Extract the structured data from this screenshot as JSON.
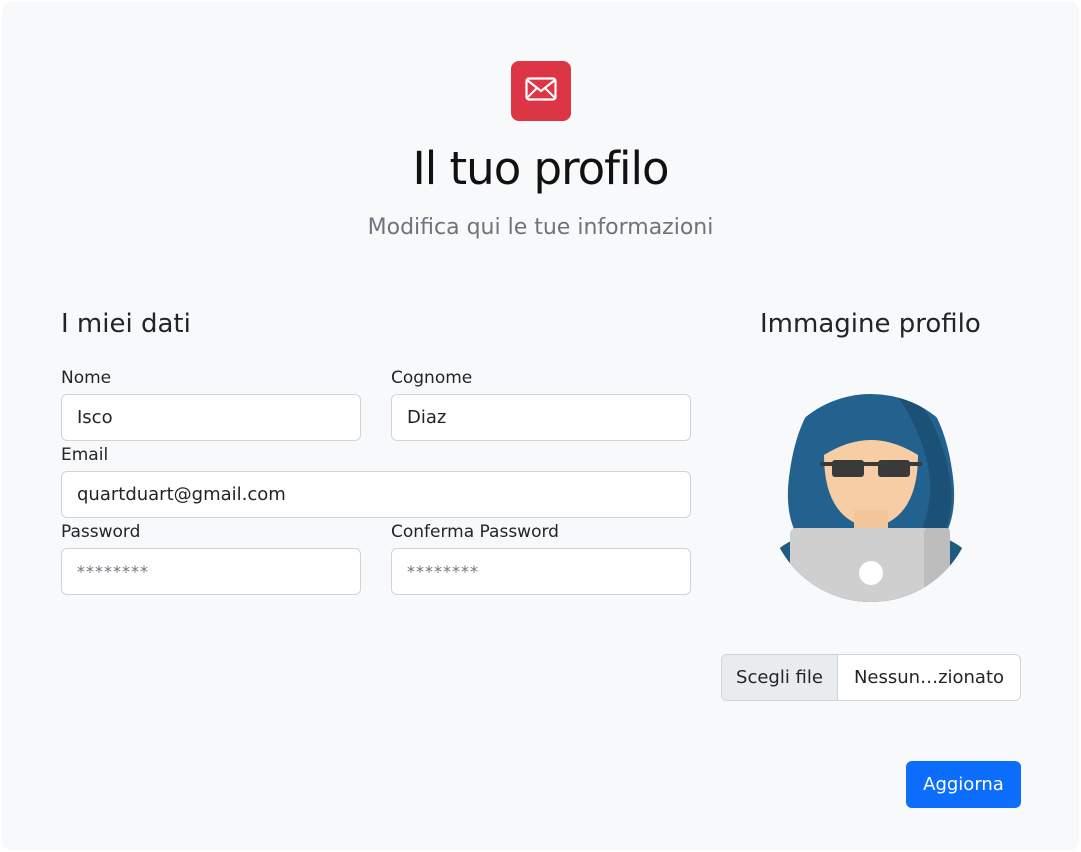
{
  "header": {
    "icon": "envelope-icon",
    "title": "Il tuo profilo",
    "subtitle": "Modifica qui le tue informazioni"
  },
  "form": {
    "section_title": "I miei dati",
    "first_name": {
      "label": "Nome",
      "value": "Isco"
    },
    "last_name": {
      "label": "Cognome",
      "value": "Diaz"
    },
    "email": {
      "label": "Email",
      "value": "quartduart@gmail.com"
    },
    "password": {
      "label": "Password",
      "placeholder": "********"
    },
    "confirm_password": {
      "label": "Conferma Password",
      "placeholder": "********"
    }
  },
  "profile_image": {
    "section_title": "Immagine profilo",
    "avatar": "hacker-avatar",
    "file_button": "Scegli file",
    "file_status": "Nessun…zionato"
  },
  "actions": {
    "submit_label": "Aggiorna"
  },
  "colors": {
    "accent": "#0d6efd",
    "logo_bg": "#dc3545",
    "background": "#f8f9fa"
  }
}
